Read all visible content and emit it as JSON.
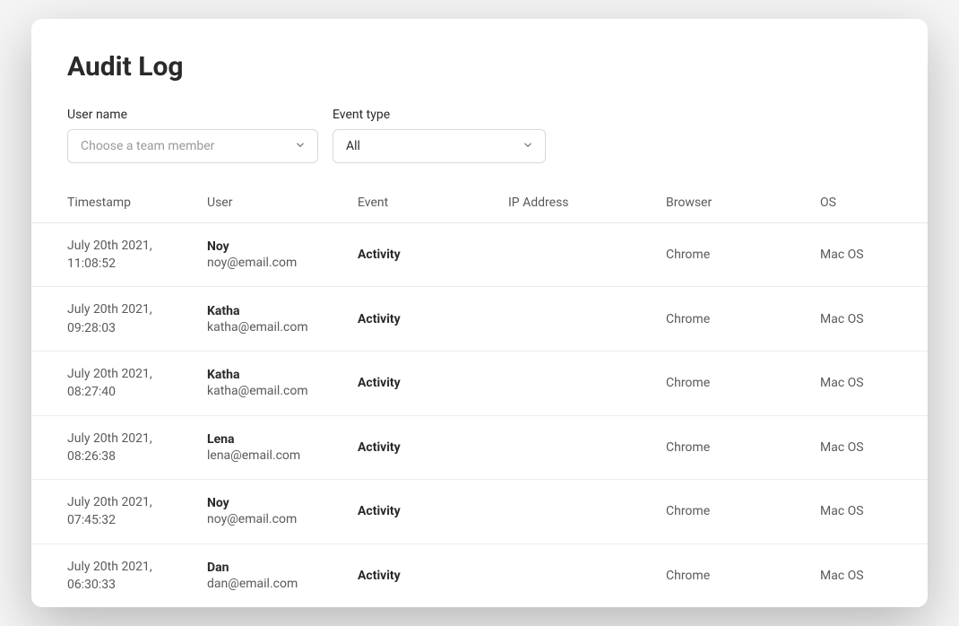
{
  "page": {
    "title": "Audit Log"
  },
  "filters": {
    "user_name": {
      "label": "User name",
      "placeholder": "Choose a team member",
      "value": ""
    },
    "event_type": {
      "label": "Event type",
      "value": "All"
    }
  },
  "table": {
    "headers": {
      "timestamp": "Timestamp",
      "user": "User",
      "event": "Event",
      "ip": "IP Address",
      "browser": "Browser",
      "os": "OS"
    },
    "rows": [
      {
        "timestamp": "July 20th 2021, 11:08:52",
        "user_name": "Noy",
        "user_email": "noy@email.com",
        "event": "Activity",
        "ip": "",
        "browser": "Chrome",
        "os": "Mac OS"
      },
      {
        "timestamp": "July 20th 2021, 09:28:03",
        "user_name": "Katha",
        "user_email": "katha@email.com",
        "event": "Activity",
        "ip": "",
        "browser": "Chrome",
        "os": "Mac OS"
      },
      {
        "timestamp": "July 20th 2021, 08:27:40",
        "user_name": "Katha",
        "user_email": "katha@email.com",
        "event": "Activity",
        "ip": "",
        "browser": "Chrome",
        "os": "Mac OS"
      },
      {
        "timestamp": "July 20th 2021, 08:26:38",
        "user_name": "Lena",
        "user_email": "lena@email.com",
        "event": "Activity",
        "ip": "",
        "browser": "Chrome",
        "os": "Mac OS"
      },
      {
        "timestamp": "July 20th 2021, 07:45:32",
        "user_name": "Noy",
        "user_email": "noy@email.com",
        "event": "Activity",
        "ip": "",
        "browser": "Chrome",
        "os": "Mac OS"
      },
      {
        "timestamp": "July 20th 2021, 06:30:33",
        "user_name": "Dan",
        "user_email": "dan@email.com",
        "event": "Activity",
        "ip": "",
        "browser": "Chrome",
        "os": "Mac OS"
      }
    ]
  }
}
